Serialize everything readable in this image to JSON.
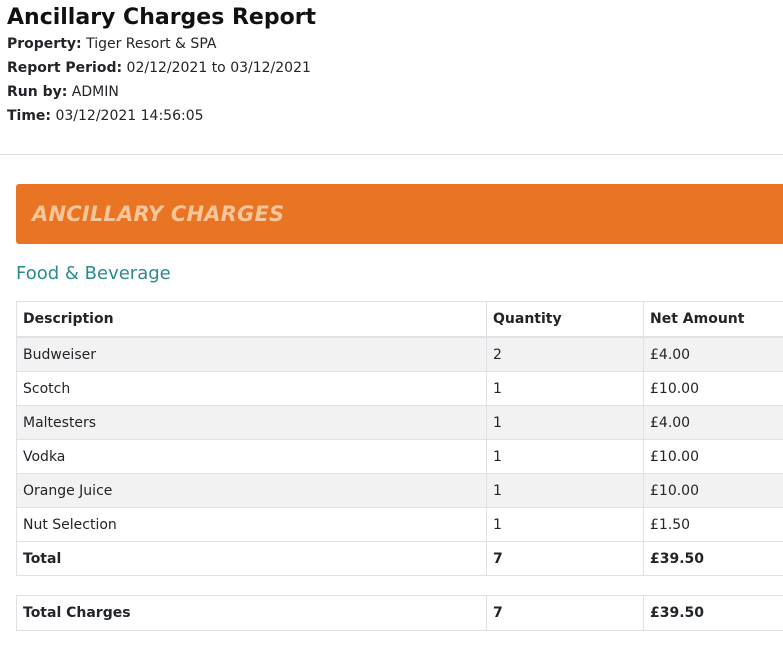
{
  "report": {
    "title": "Ancillary Charges Report",
    "property_label": "Property:",
    "property_value": "Tiger Resort & SPA",
    "period_label": "Report Period:",
    "period_value": "02/12/2021 to 03/12/2021",
    "runby_label": "Run by:",
    "runby_value": "ADMIN",
    "time_label": "Time:",
    "time_value": "03/12/2021 14:56:05"
  },
  "banner": {
    "text": "ANCILLARY CHARGES"
  },
  "section": {
    "title": "Food & Beverage",
    "columns": [
      "Description",
      "Quantity",
      "Net Amount"
    ],
    "rows": [
      {
        "description": "Budweiser",
        "quantity": "2",
        "net": "£4.00"
      },
      {
        "description": "Scotch",
        "quantity": "1",
        "net": "£10.00"
      },
      {
        "description": "Maltesters",
        "quantity": "1",
        "net": "£4.00"
      },
      {
        "description": "Vodka",
        "quantity": "1",
        "net": "£10.00"
      },
      {
        "description": "Orange Juice",
        "quantity": "1",
        "net": "£10.00"
      },
      {
        "description": "Nut Selection",
        "quantity": "1",
        "net": "£1.50"
      }
    ],
    "total": {
      "label": "Total",
      "quantity": "7",
      "net": "£39.50"
    }
  },
  "grand_total": {
    "label": "Total Charges",
    "quantity": "7",
    "net": "£39.50"
  },
  "colors": {
    "banner": "#e87424",
    "banner_text": "#f7c59a",
    "section_title": "#2a8a8c"
  }
}
